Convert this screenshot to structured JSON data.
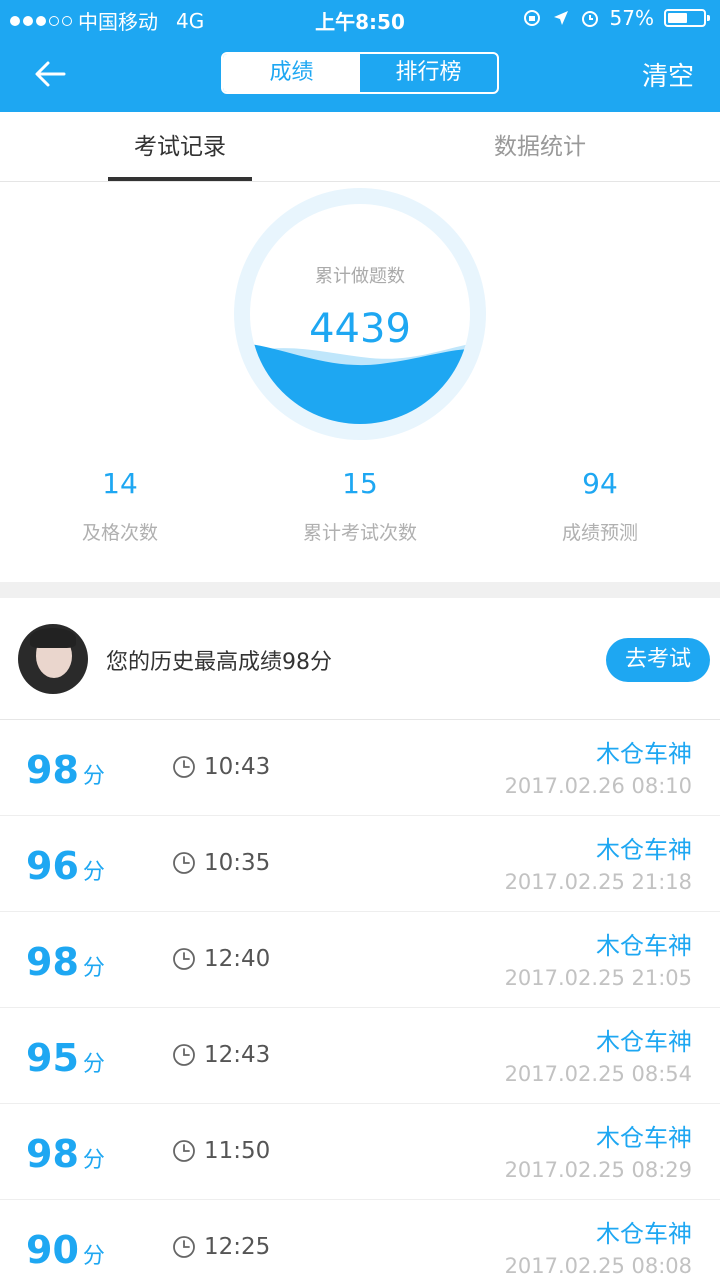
{
  "status_bar": {
    "carrier": "中国移动",
    "network": "4G",
    "time": "上午8:50",
    "battery": "57%",
    "battery_level": 0.57
  },
  "navbar": {
    "segments": [
      "成绩",
      "排行榜"
    ],
    "active_segment": "成绩",
    "clear_label": "清空"
  },
  "tabs": [
    {
      "label": "考试记录",
      "active": true
    },
    {
      "label": "数据统计",
      "active": false
    }
  ],
  "summary": {
    "total_label": "累计做题数",
    "total_value": "4439",
    "stats": [
      {
        "value": "14",
        "label": "及格次数"
      },
      {
        "value": "15",
        "label": "累计考试次数"
      },
      {
        "value": "94",
        "label": "成绩预测"
      }
    ]
  },
  "best": {
    "text": "您的历史最高成绩98分",
    "button_label": "去考试"
  },
  "score_unit": "分",
  "records": [
    {
      "score": "98",
      "duration": "10:43",
      "name": "木仓车神",
      "date": "2017.02.26 08:10"
    },
    {
      "score": "96",
      "duration": "10:35",
      "name": "木仓车神",
      "date": "2017.02.25 21:18"
    },
    {
      "score": "98",
      "duration": "12:40",
      "name": "木仓车神",
      "date": "2017.02.25 21:05"
    },
    {
      "score": "95",
      "duration": "12:43",
      "name": "木仓车神",
      "date": "2017.02.25 08:54"
    },
    {
      "score": "98",
      "duration": "11:50",
      "name": "木仓车神",
      "date": "2017.02.25 08:29"
    },
    {
      "score": "90",
      "duration": "12:25",
      "name": "木仓车神",
      "date": "2017.02.25 08:08"
    }
  ],
  "colors": {
    "accent": "#1ea7f2",
    "muted": "#b0b0b0",
    "divider": "#eeeeee"
  },
  "icons": [
    "back-arrow-icon",
    "location-arrow-icon",
    "alarm-icon",
    "clock-icon"
  ]
}
